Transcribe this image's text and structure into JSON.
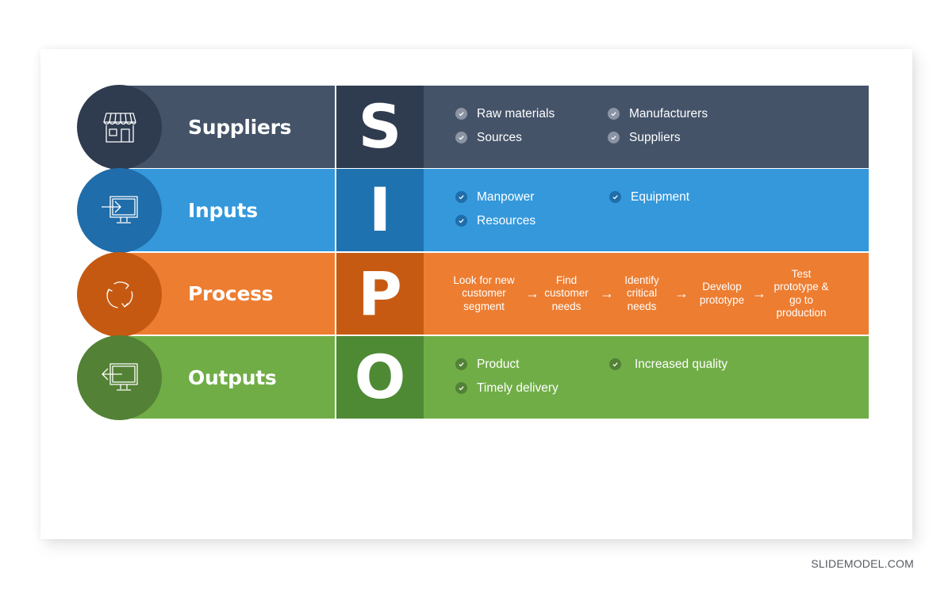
{
  "brand": "SLIDEMODEL.COM",
  "colors": {
    "suppliers": {
      "bar": "#445368",
      "block": "#2f3b4f",
      "circle": "#2f3b4f",
      "check": "#8a94a5"
    },
    "inputs": {
      "bar": "#3498db",
      "block": "#1f72b0",
      "circle": "#1f6daa",
      "check": "#1f6daa"
    },
    "process": {
      "bar": "#ed7d31",
      "block": "#c75a12",
      "circle": "#c65911",
      "check": "#c65911"
    },
    "outputs": {
      "bar": "#70ad47",
      "block": "#4e8a34",
      "circle": "#538135",
      "check": "#538135"
    }
  },
  "rows": [
    {
      "key": "suppliers",
      "icon": "storefront-icon",
      "title": "Suppliers",
      "letter": "S",
      "bullets": [
        "Raw materials",
        "Manufacturers",
        "Sources",
        "Suppliers"
      ]
    },
    {
      "key": "inputs",
      "icon": "monitor-input-icon",
      "title": "Inputs",
      "letter": "I",
      "bullets": [
        "Manpower",
        "Equipment",
        "Resources"
      ]
    },
    {
      "key": "process",
      "icon": "cycle-arrows-icon",
      "title": "Process",
      "letter": "P",
      "steps": [
        [
          "Look for new",
          "customer",
          "segment"
        ],
        [
          "Find",
          "customer",
          "needs"
        ],
        [
          "Identify",
          "critical",
          "needs"
        ],
        [
          "Develop",
          "prototype"
        ],
        [
          "Test",
          "prototype &",
          "go to",
          "production"
        ]
      ],
      "arrow": "→"
    },
    {
      "key": "outputs",
      "icon": "monitor-output-icon",
      "title": "Outputs",
      "letter": "O",
      "bullets": [
        "Product",
        "Increased quality",
        "Timely delivery"
      ]
    }
  ]
}
